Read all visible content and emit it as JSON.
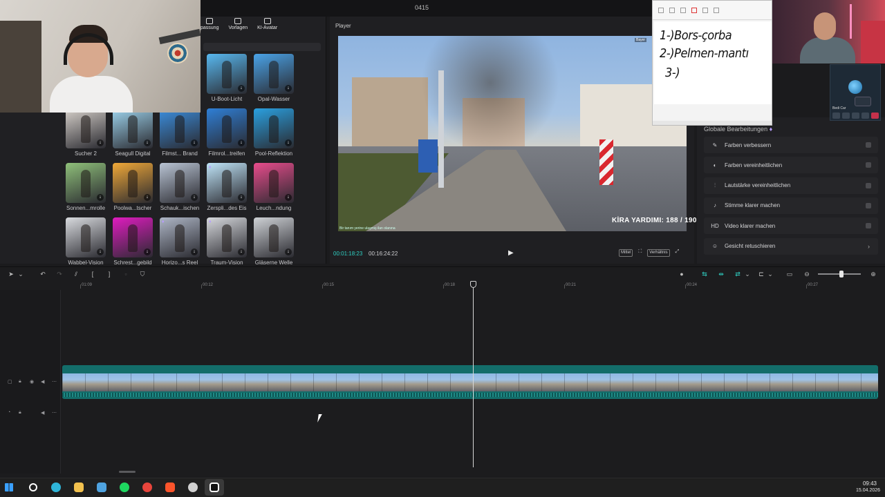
{
  "window": {
    "title": "0415"
  },
  "library": {
    "tabs": [
      {
        "label": "passung",
        "icon": "sliders-icon"
      },
      {
        "label": "Vorlagen",
        "icon": "template-icon"
      },
      {
        "label": "KI-Avatar",
        "icon": "avatar-icon"
      }
    ],
    "effects": [
      {
        "label": "U-Boot-Licht",
        "color": "#58b8f0"
      },
      {
        "label": "Opal-Wasser",
        "color": "#4aa3e8"
      },
      {
        "label": "Sucher 2",
        "color": "#d8d2cc"
      },
      {
        "label": "Seagull Digital",
        "color": "#9fd6f0"
      },
      {
        "label": "Filmst... Brand",
        "color": "#3b8fe0"
      },
      {
        "label": "Filmrol...treifen",
        "color": "#2f7fd6"
      },
      {
        "label": "Pool-Reflektion",
        "color": "#2aa0e0"
      },
      {
        "label": "Sonnen...mrolle",
        "color": "#8fc07a"
      },
      {
        "label": "Poolwa...tscher",
        "color": "#f0a838"
      },
      {
        "label": "Schauk...ischen",
        "color": "#b9c4d4"
      },
      {
        "label": "Zerspli...des Eis",
        "color": "#bfe4f8"
      },
      {
        "label": "Leuch...ndung",
        "color": "#e84c8c"
      },
      {
        "label": "Wabbel-Vision",
        "color": "#d9dbdf"
      },
      {
        "label": "Schrest...gebild",
        "color": "#e01cc0"
      },
      {
        "label": "Horizo...s Reel",
        "color": "#aeb6c6"
      },
      {
        "label": "Traum-Vision",
        "color": "#d6d8dc"
      },
      {
        "label": "Gläserne Welle",
        "color": "#cfd2d6"
      }
    ]
  },
  "player": {
    "title": "Player",
    "overlay_text": "KİRA YARDIMI:  188 / 190",
    "caption": "Bir tanım yerine ulaşmış ilan olanına",
    "channel_tag": "Bayer",
    "current_time": "00:01:18:23",
    "total_time": "00:16:24:22",
    "btn_mittel": "Mittel",
    "btn_ratio": "Verhältnis"
  },
  "global_edits": {
    "title": "Globale Bearbeitungen",
    "items": [
      {
        "label": "Farben verbessern",
        "icon": "palette-icon"
      },
      {
        "label": "Farben vereinheitlichen",
        "icon": "color-match-icon"
      },
      {
        "label": "Lautstärke vereinheitlichen",
        "icon": "volume-level-icon"
      },
      {
        "label": "Stimme klarer machen",
        "icon": "voice-icon"
      },
      {
        "label": "Video klarer machen",
        "icon": "hd-icon"
      },
      {
        "label": "Gesicht retuschieren",
        "icon": "face-retouch-icon"
      }
    ]
  },
  "paint": {
    "lines": [
      "1-)Bors-çorba",
      "2-)Pelmen-mantı",
      "3-)"
    ]
  },
  "call": {
    "name": "Bedi Car"
  },
  "timeline": {
    "ticks": [
      "01:09",
      "00:12",
      "00:15",
      "00:18",
      "00:21",
      "00:24",
      "00:27"
    ]
  },
  "taskbar": {
    "apps": [
      {
        "name": "windows-start",
        "color": "#3aa0ff"
      },
      {
        "name": "search",
        "color": "#ffffff"
      },
      {
        "name": "edge",
        "color": "#2fb5d9"
      },
      {
        "name": "file-explorer",
        "color": "#f2c14e"
      },
      {
        "name": "app-blue",
        "color": "#4fa3e0"
      },
      {
        "name": "spotify",
        "color": "#1ed760"
      },
      {
        "name": "chrome",
        "color": "#e8453c"
      },
      {
        "name": "brave",
        "color": "#fb542b"
      },
      {
        "name": "obs",
        "color": "#d0d0d0"
      },
      {
        "name": "capcut",
        "color": "#ffffff"
      }
    ],
    "time": "09:43",
    "date": "15.04.2026"
  }
}
